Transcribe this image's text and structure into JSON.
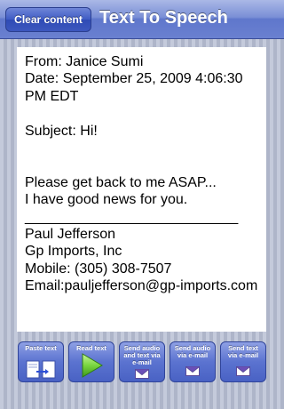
{
  "nav": {
    "title": "Text To Speech",
    "clear_label": "Clear content"
  },
  "message": {
    "text": "From: Janice Sumi\nDate: September 25, 2009 4:06:30 PM EDT\n\nSubject: Hi!\n\n\nPlease get back to me ASAP...\nI have good news for you.\n___________________________\nPaul Jefferson\nGp Imports, Inc\nMobile: (305) 308-7507\nEmail:pauljefferson@gp-imports.com"
  },
  "toolbar": {
    "paste_label": "Paste text",
    "read_label": "Read text",
    "send_audio_text_label": "Send audio and text via e-mail",
    "send_audio_label": "Send audio via e-mail",
    "send_text_label": "Send text via e-mail",
    "icons": {
      "paste": "clipboard-icon",
      "read": "play-icon",
      "send_audio_text": "envelope-icon",
      "send_audio": "envelope-icon",
      "send_text": "envelope-icon"
    }
  },
  "colors": {
    "nav_bar": "#6a80d0",
    "button": "#4962c4",
    "play_arrow": "#6fd13c",
    "envelope_flap": "#6b4fb8",
    "background": "#b8bed0"
  }
}
